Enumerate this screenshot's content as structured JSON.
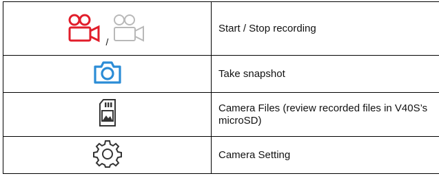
{
  "rows": [
    {
      "icon_names": [
        "video-camera-record-icon-red",
        "video-camera-record-icon-gray"
      ],
      "separator": "/",
      "label": "Start / Stop recording"
    },
    {
      "icon_names": [
        "camera-snapshot-icon"
      ],
      "label": "Take snapshot"
    },
    {
      "icon_names": [
        "sd-card-image-icon"
      ],
      "label": "Camera Files (review recorded files in V40S’s microSD)"
    },
    {
      "icon_names": [
        "gear-icon"
      ],
      "label": "Camera Setting"
    }
  ],
  "colors": {
    "record_active": "#e11d2a",
    "record_inactive": "#b8b8b8",
    "snapshot": "#2b8cd6",
    "neutral_icon": "#333333",
    "border": "#000000"
  }
}
